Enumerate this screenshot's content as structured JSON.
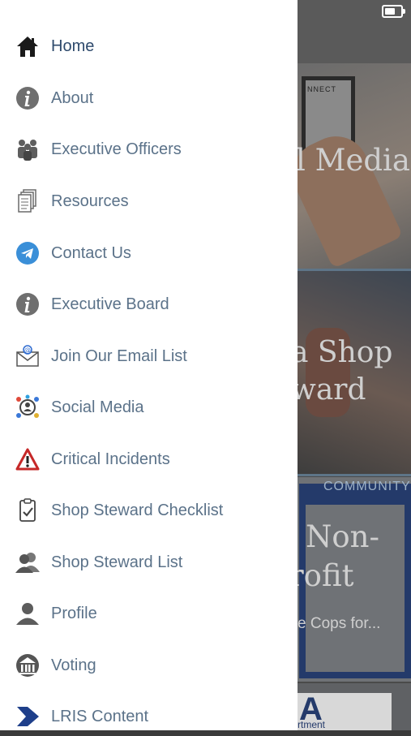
{
  "drawer": {
    "items": [
      {
        "label": "Home",
        "icon": "home-icon",
        "active": true
      },
      {
        "label": "About",
        "icon": "info-icon"
      },
      {
        "label": "Executive Officers",
        "icon": "people-group-icon"
      },
      {
        "label": "Resources",
        "icon": "documents-icon"
      },
      {
        "label": "Contact Us",
        "icon": "telegram-icon"
      },
      {
        "label": "Executive Board",
        "icon": "info-icon"
      },
      {
        "label": "Join Our Email List",
        "icon": "email-at-icon"
      },
      {
        "label": "Social Media",
        "icon": "social-network-icon"
      },
      {
        "label": "Critical Incidents",
        "icon": "warning-triangle-icon"
      },
      {
        "label": "Shop Steward Checklist",
        "icon": "clipboard-check-icon"
      },
      {
        "label": "Shop Steward List",
        "icon": "people-pair-icon"
      },
      {
        "label": "Profile",
        "icon": "person-icon"
      },
      {
        "label": "Voting",
        "icon": "vote-building-icon"
      },
      {
        "label": "LRIS Content",
        "icon": "chevron-logo-icon"
      }
    ]
  },
  "background": {
    "card1_text": "l Media",
    "card1_tablet_text": "NNECT",
    "card2_line1": "a Shop",
    "card2_line2": "ward",
    "card3_banner": "COMMUNITY",
    "card3_line1": "Non-",
    "card3_line2": "rofit",
    "card3_sub": "e Cops for...",
    "card4_badge": "A",
    "card4_badge_sub": "rtment"
  },
  "colors": {
    "label": "#5b7289",
    "active_label": "#2e4a6c",
    "overlay": "#4a4a4a",
    "warning": "#c62828",
    "telegram": "#3a8fd8",
    "lris": "#1e3f8a"
  }
}
